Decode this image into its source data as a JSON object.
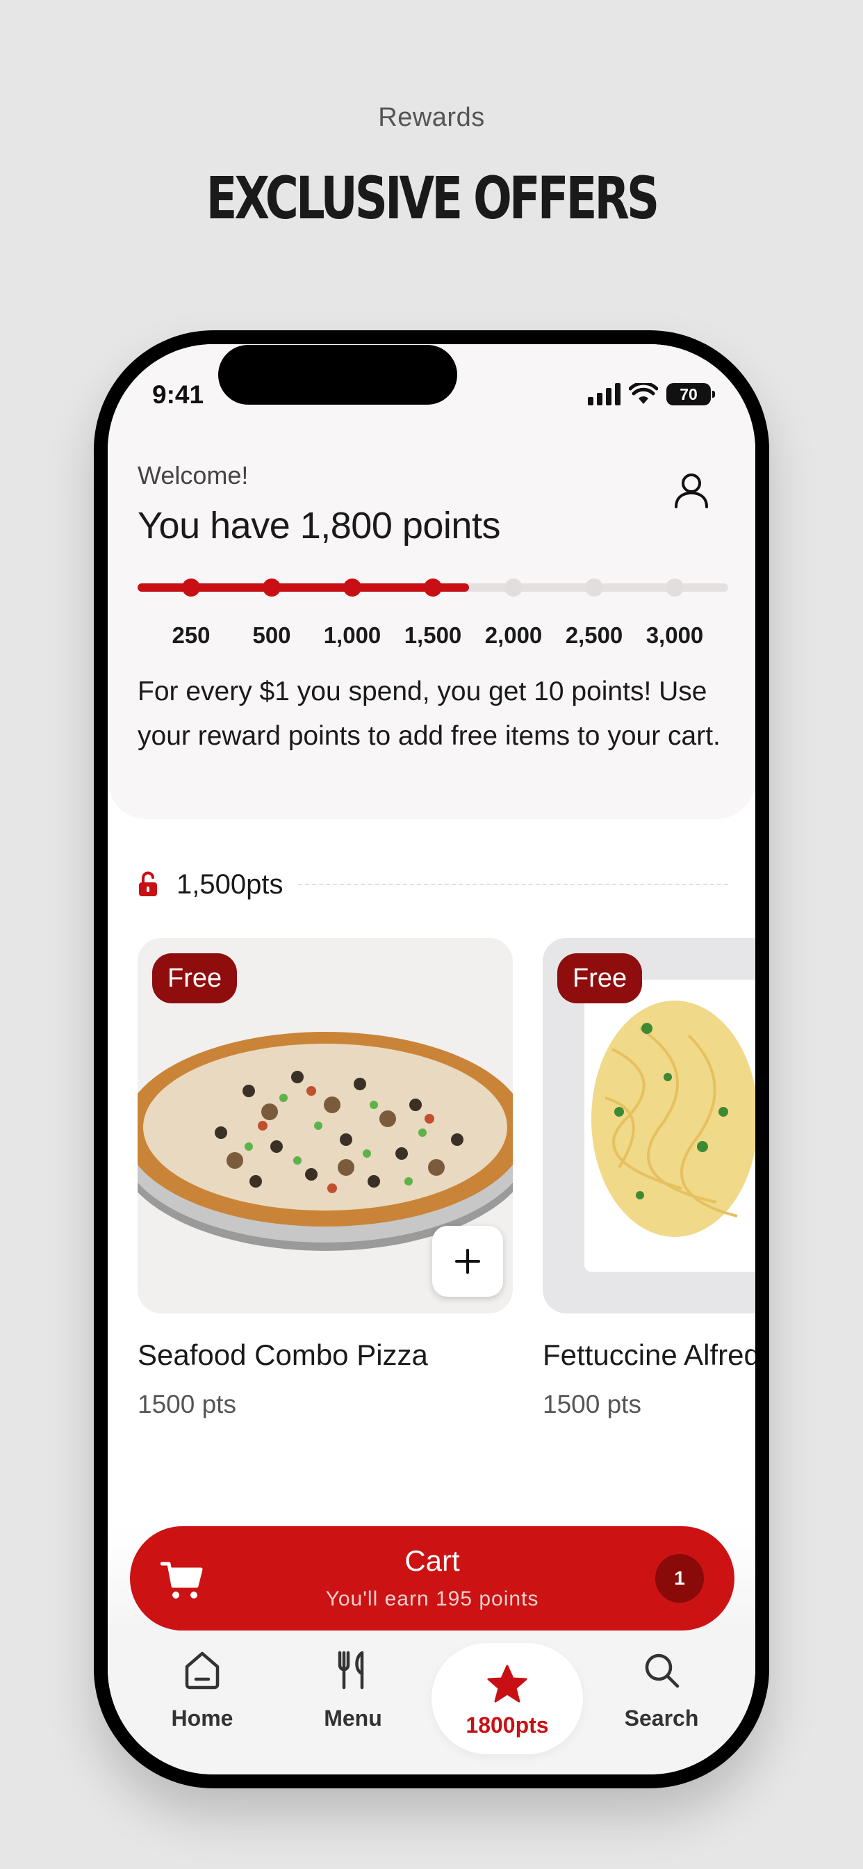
{
  "page": {
    "overline": "Rewards",
    "headline": "EXCLUSIVE OFFERS"
  },
  "status_bar": {
    "time": "9:41",
    "battery": "70"
  },
  "header": {
    "greeting": "Welcome!",
    "points_summary": "You have 1,800 points",
    "description": "For every $1 you spend, you get 10 points! Use your reward points to add free items to your cart."
  },
  "progress": {
    "current_points": 1800,
    "max_points": 3000,
    "milestones": [
      {
        "label": "250",
        "reached": true
      },
      {
        "label": "500",
        "reached": true
      },
      {
        "label": "1,000",
        "reached": true
      },
      {
        "label": "1,500",
        "reached": true
      },
      {
        "label": "2,000",
        "reached": false
      },
      {
        "label": "2,500",
        "reached": false
      },
      {
        "label": "3,000",
        "reached": false
      }
    ]
  },
  "tier": {
    "label": "1,500pts",
    "icon": "unlocked-icon"
  },
  "items": [
    {
      "badge": "Free",
      "name": "Seafood Combo Pizza",
      "points": "1500 pts",
      "image": "pizza"
    },
    {
      "badge": "Free",
      "name": "Fettuccine Alfredo",
      "points": "1500 pts",
      "image": "pasta"
    }
  ],
  "cart": {
    "title": "Cart",
    "subtitle": "You'll earn 195 points",
    "count": "1"
  },
  "tabs": [
    {
      "label": "Home",
      "icon": "home-icon",
      "active": false
    },
    {
      "label": "Menu",
      "icon": "utensils-icon",
      "active": false
    },
    {
      "label": "1800pts",
      "icon": "star-icon",
      "active": true
    },
    {
      "label": "Search",
      "icon": "search-icon",
      "active": false
    }
  ],
  "colors": {
    "brand_red": "#cc1213",
    "badge_red": "#8f0d0d",
    "background": "#e6e6e6"
  }
}
